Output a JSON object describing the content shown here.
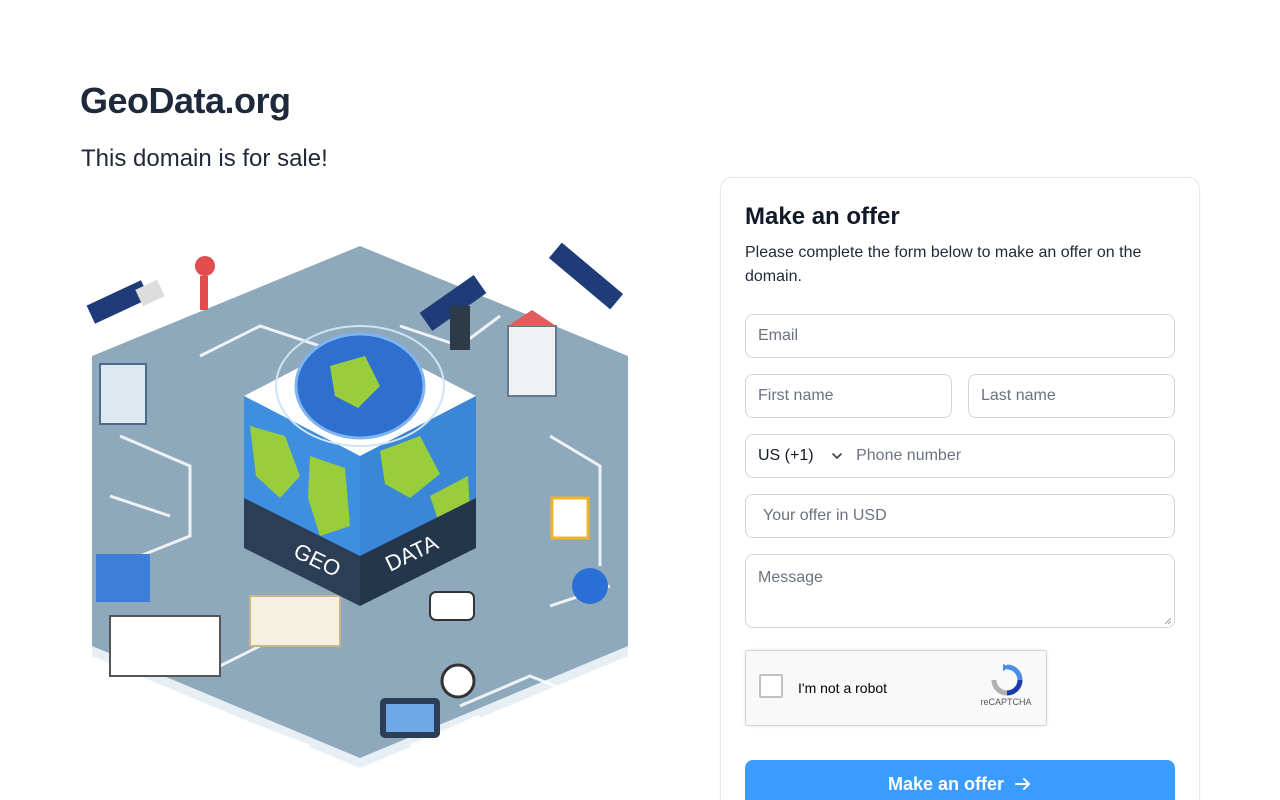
{
  "site": {
    "title": "GeoData.org",
    "subtitle": "This domain is for sale!"
  },
  "illustration": {
    "cube_left_text": "GEO",
    "cube_right_text": "DATA"
  },
  "form": {
    "title": "Make an offer",
    "description": "Please complete the form below to make an offer on the domain.",
    "email_placeholder": "Email",
    "first_name_placeholder": "First name",
    "last_name_placeholder": "Last name",
    "country_code": "US (+1)",
    "phone_placeholder": "Phone number",
    "offer_placeholder": "Your offer in USD",
    "message_placeholder": "Message",
    "captcha_label": "I'm not a robot",
    "captcha_brand": "reCAPTCHA",
    "submit_label": "Make an offer"
  },
  "colors": {
    "accent": "#3b9cff",
    "title": "#1e293b",
    "illustration_base": "#8ea9bb"
  },
  "icons": {
    "country_dropdown": "chevron-down-icon",
    "submit": "arrow-right-icon",
    "captcha": "recaptcha-icon"
  }
}
